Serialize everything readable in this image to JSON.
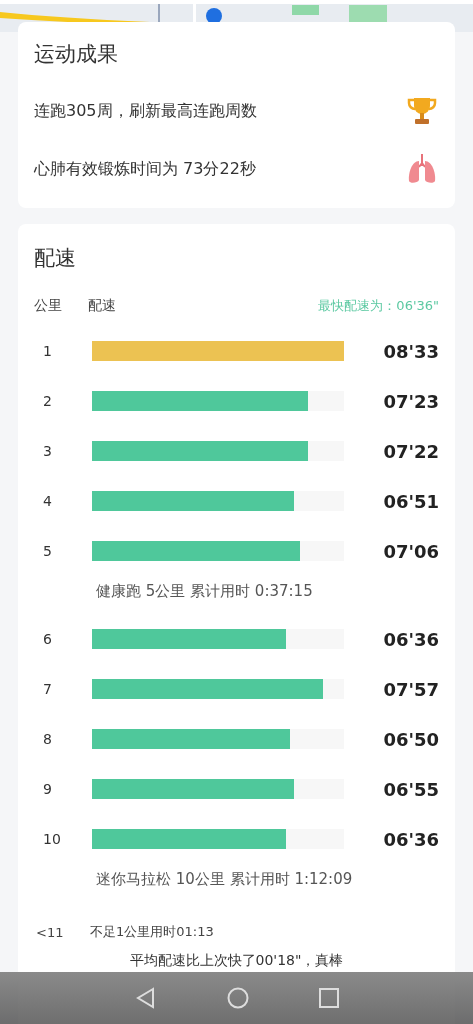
{
  "achievements": {
    "title": "运动成果",
    "items": [
      {
        "text": "连跑305周，刷新最高连跑周数",
        "kind": "trophy"
      },
      {
        "text": "心肺有效锻炼时间为 73分22秒",
        "kind": "lungs"
      }
    ]
  },
  "pace": {
    "title": "配速",
    "columns": [
      "公里",
      "配速"
    ],
    "fastest": "最快配速为：06'36\"",
    "groups": [
      {
        "rows": [
          {
            "km": "1",
            "level": 1.0,
            "color": "#ecc252",
            "time": "08'33"
          },
          {
            "km": "2",
            "level": 0.857,
            "color": "#4fc89b",
            "time": "07'23"
          },
          {
            "km": "3",
            "level": 0.857,
            "color": "#4fc89b",
            "time": "07'22"
          },
          {
            "km": "4",
            "level": 0.8,
            "color": "#4fc89b",
            "time": "06'51"
          },
          {
            "km": "5",
            "level": 0.825,
            "color": "#4fc89b",
            "time": "07'06"
          }
        ],
        "summary": "健康跑 5公里 累计用时 0:37:15"
      },
      {
        "rows": [
          {
            "km": "6",
            "level": 0.77,
            "color": "#4fc89b",
            "time": "06'36"
          },
          {
            "km": "7",
            "level": 0.917,
            "color": "#4fc89b",
            "time": "07'57"
          },
          {
            "km": "8",
            "level": 0.786,
            "color": "#4fc89b",
            "time": "06'50"
          },
          {
            "km": "9",
            "level": 0.8,
            "color": "#4fc89b",
            "time": "06'55"
          },
          {
            "km": "10",
            "level": 0.77,
            "color": "#4fc89b",
            "time": "06'36"
          }
        ],
        "summary": "迷你马拉松 10公里 累计用时 1:12:09"
      }
    ],
    "remainder": {
      "km": "<11",
      "text": "不足1公里用时01:13"
    },
    "comparison": "平均配速比上次快了00'18\"，真棒"
  }
}
